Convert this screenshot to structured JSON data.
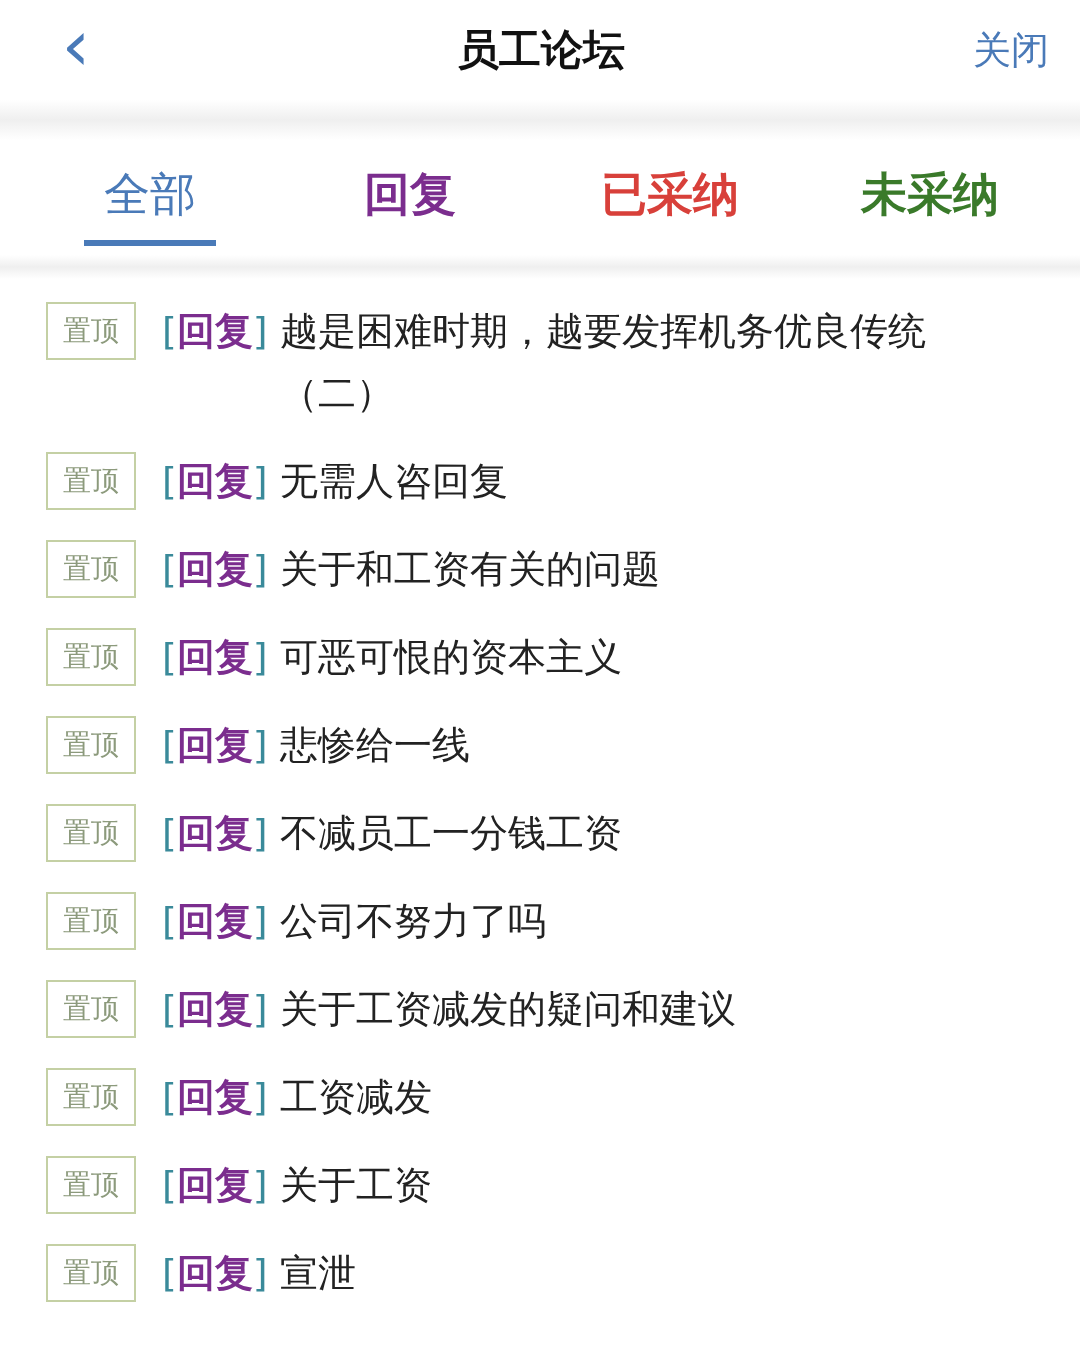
{
  "header": {
    "back": "‹",
    "title": "员工论坛",
    "close": "关闭"
  },
  "tabs": [
    {
      "label": "全部",
      "selected": true,
      "color": "#4a7ab8"
    },
    {
      "label": "回复",
      "selected": false,
      "color": "#7b2d8e"
    },
    {
      "label": "已采纳",
      "selected": false,
      "color": "#d8403a"
    },
    {
      "label": "未采纳",
      "selected": false,
      "color": "#3a7a2a"
    }
  ],
  "posts": [
    {
      "badge": "置顶",
      "tag": "[回复]",
      "title": "越是困难时期，越要发挥机务优良传统（二）"
    },
    {
      "badge": "置顶",
      "tag": "[回复]",
      "title": "无需人咨回复"
    },
    {
      "badge": "置顶",
      "tag": "[回复]",
      "title": "关于和工资有关的问题"
    },
    {
      "badge": "置顶",
      "tag": "[回复]",
      "title": "可恶可恨的资本主义"
    },
    {
      "badge": "置顶",
      "tag": "[回复]",
      "title": "悲惨给一线"
    },
    {
      "badge": "置顶",
      "tag": "[回复]",
      "title": "不减员工一分钱工资"
    },
    {
      "badge": "置顶",
      "tag": "[回复]",
      "title": "公司不努力了吗"
    },
    {
      "badge": "置顶",
      "tag": "[回复]",
      "title": "关于工资减发的疑问和建议"
    },
    {
      "badge": "置顶",
      "tag": "[回复]",
      "title": "工资减发"
    },
    {
      "badge": "置顶",
      "tag": "[回复]",
      "title": "关于工资"
    },
    {
      "badge": "置顶",
      "tag": "[回复]",
      "title": "宣泄"
    }
  ]
}
